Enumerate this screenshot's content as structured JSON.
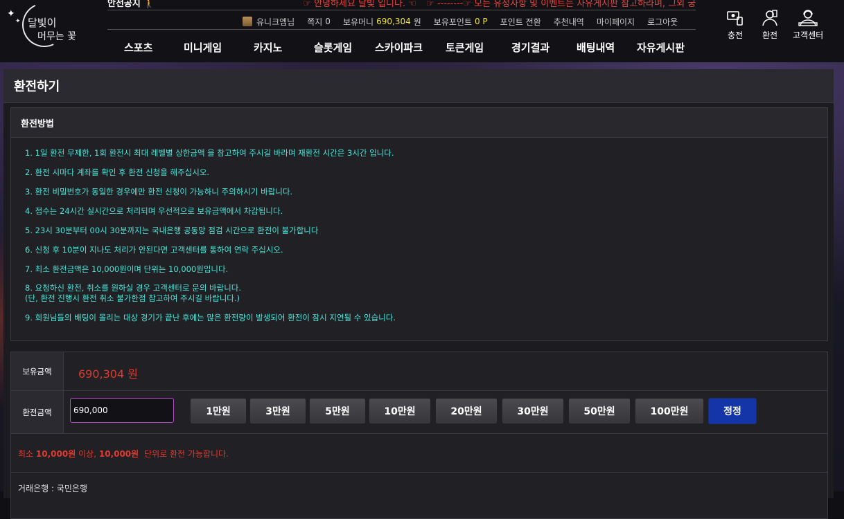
{
  "logo": {
    "line1": "달빛이",
    "line2": "머무는 꽃"
  },
  "ticker": {
    "label": "안전공지",
    "message": "☞ 안녕하세요 달빛 입니다. ☜",
    "message2": "☞ --------☞ 모든 유정사항 및 이벤트는 자유게시판 참고하라며, 그외 궁금하"
  },
  "userbar": {
    "level": "유니크엠님",
    "message_label": "쪽지",
    "message_count": "0",
    "money_label": "보유머니",
    "money_value": "690,304",
    "money_unit": "원",
    "point_label": "보유포인트",
    "point_value": "0 P",
    "point_convert": "포인트 전환",
    "referrals": "추천내역",
    "mypage": "마이페이지",
    "logout": "로그아웃"
  },
  "nav": [
    "스포츠",
    "미니게임",
    "카지노",
    "슬롯게임",
    "스카이파크",
    "토큰게임",
    "경기결과",
    "배팅내역",
    "자유게시판"
  ],
  "quick": {
    "deposit": "충전",
    "withdraw": "환전",
    "support": "고객센터"
  },
  "page_title": "환전하기",
  "rules": {
    "heading": "환전방법",
    "items": [
      "1. 1일 환전 무제한, 1회 환전시 최대 레벨별 상한금액 을 참고하여 주시길 바라며 재환전 시간은 3시간 입니다.",
      "2. 환전 시마다 계좌를 확인 후 환전 신청을 해주십시오.",
      "3. 환전 비밀번호가 동일한 경우에만 환전 신청이 가능하니 주의하시기 바랍니다.",
      "4. 접수는 24시간 실시간으로 처리되며 우선적으로 보유금액에서 차감됩니다.",
      "5. 23시 30분부터 00시 30분까지는 국내은행 공동망 점검 시간으로 환전이 불가합니다",
      "6. 신청 후 10분이 지나도 처리가 안된다면 고객센터를 통하여 연락 주십시오.",
      "7. 최소 환전금액은 10,000원이며 단위는 10,000원입니다.",
      "8. 요청하신 환전, 취소를 원하실 경우 고객센터로 문의 바랍니다.\n(단, 환전 진행시 환전 취소 불가한점 참고하여 주시길 바랍니다.)",
      "9. 회원님들의 배팅이 몰리는 대상 경기가 끝난 후에는 많은 환전량이 발생되어 환전이 잠시 지연될 수 있습니다."
    ]
  },
  "form": {
    "balance_label": "보유금액",
    "balance_value": "690,304 원",
    "amount_label": "환전금액",
    "amount_value": "690,000",
    "quick_buttons": [
      "1만원",
      "3만원",
      "5만원",
      "10만원",
      "20만원",
      "30만원",
      "50만원",
      "100만원"
    ],
    "correct_button": "정정",
    "notice_pre": "최소",
    "notice_min": "10,000원",
    "notice_mid": "이상,",
    "notice_unit": "10,000원",
    "notice_post": "단위로 환전 가능합니다.",
    "bank": "거래은행 : 국민은행"
  },
  "colors": {
    "accent_red": "#e03a2f",
    "rule_text": "#4ee6d9",
    "money_yellow": "#f2e33a",
    "correct_blue": "#1435a8"
  }
}
